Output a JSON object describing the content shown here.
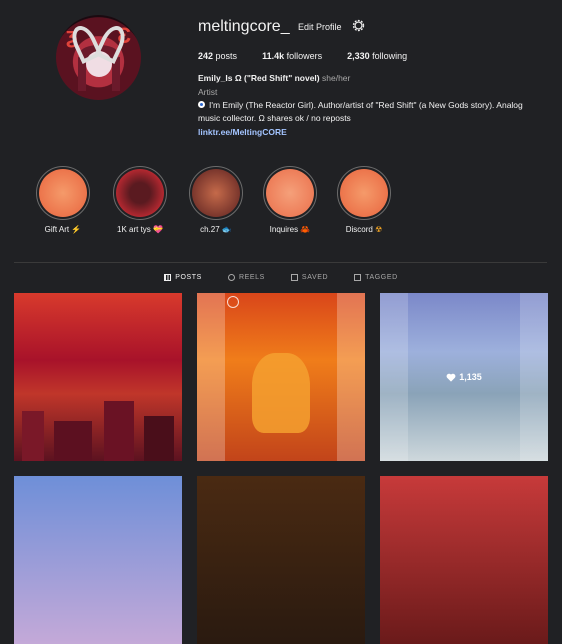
{
  "profile": {
    "username": "meltingcore_",
    "edit_label": "Edit Profile",
    "posts_count": "242",
    "posts_label": "posts",
    "followers_count": "11.4k",
    "followers_label": "followers",
    "following_count": "2,330",
    "following_label": "following",
    "display_name": "Emily_Is Ω (\"Red Shift\" novel)",
    "pronouns": "she/her",
    "category": "Artist",
    "bio": "I'm Emily (The Reactor Girl). Author/artist of \"Red Shift\" (a New Gods story). Analog music collector. Ω shares ok / no reposts",
    "link": "linktr.ee/MeltingCORE"
  },
  "highlights": [
    {
      "label": "Gift Art",
      "emoji": "⚡",
      "color": "#f07a4e"
    },
    {
      "label": "1K art tys",
      "emoji": "💝",
      "color": "#b32830"
    },
    {
      "label": "ch.27",
      "emoji": "🐟",
      "color": "#8a2a2a"
    },
    {
      "label": "Inquires",
      "emoji": "🦀",
      "color": "#f0805a"
    },
    {
      "label": "Discord",
      "emoji": "☢",
      "color": "#f07a4e"
    }
  ],
  "tabs": [
    {
      "label": "POSTS",
      "icon": "grid-icon",
      "active": true
    },
    {
      "label": "REELS",
      "icon": "reels-icon",
      "active": false
    },
    {
      "label": "SAVED",
      "icon": "bookmark-icon",
      "active": false
    },
    {
      "label": "TAGGED",
      "icon": "tag-icon",
      "active": false
    }
  ],
  "posts": [
    {
      "id": "post-1",
      "likes": ""
    },
    {
      "id": "post-2",
      "likes": ""
    },
    {
      "id": "post-3",
      "likes": "1,135"
    },
    {
      "id": "post-4",
      "likes": ""
    },
    {
      "id": "post-5",
      "likes": ""
    },
    {
      "id": "post-6",
      "likes": ""
    }
  ]
}
